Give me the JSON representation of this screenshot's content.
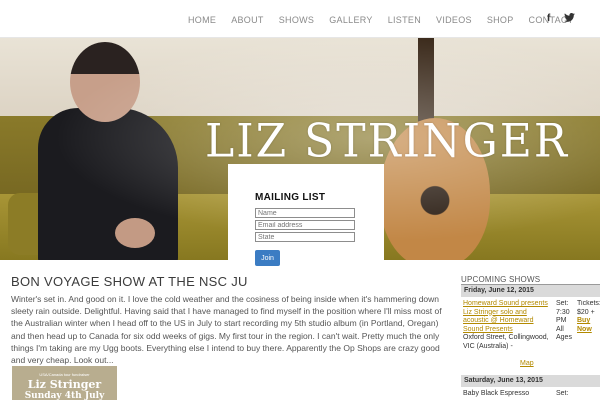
{
  "nav": {
    "items": [
      "HOME",
      "ABOUT",
      "SHOWS",
      "GALLERY",
      "LISTEN",
      "VIDEOS",
      "SHOP",
      "CONTACT"
    ],
    "social": [
      "f",
      "🐦"
    ]
  },
  "hero": {
    "logo_text": "LIZ STRINGER"
  },
  "mailing": {
    "title": "MAILING LIST",
    "name_placeholder": "Name",
    "email_placeholder": "Email address",
    "state_placeholder": "State",
    "join_label": "Join"
  },
  "post": {
    "title": "BON VOYAGE SHOW AT THE NSC JU",
    "body": "Winter's set in. And good on it. I love the cold weather and the cosiness of being inside when it's hammering down sleety rain outside. Delightful. Having said that I have managed to find myself in the position where I'll miss most of the Australian winter when I head off to the US in July to start recording my 5th studio album (in Portland, Oregan) and then head up to Canada for six odd weeks of gigs. My first tour in the region. I can't wait. Pretty much the only things I'm taking are my Ugg boots. Everything else I intend to buy there. Apparently the Op Shops are crazy good and very cheap. Look out...",
    "poster": {
      "small_text": "USA/Canada tour fundraiser",
      "name": "Liz Stringer",
      "date": "Sunday 4th July"
    }
  },
  "sidebar": {
    "title": "UPCOMING SHOWS",
    "events": [
      {
        "date": "Friday, June 12, 2015",
        "venue_link": "Homeward Sound presents Liz Stringer solo and acoustic @ Homeward Sound Presents",
        "address": "Oxford Street, Collingwood, VIC (Australia) -",
        "map": "Map",
        "time": "Set: 7:30 PM",
        "ages": "All Ages",
        "tickets": "Tickets: $20 +",
        "buy": "Buy Now"
      },
      {
        "date": "Saturday, June 13, 2015",
        "venue_link": "Baby Black Espresso",
        "time": "Set:"
      }
    ]
  }
}
